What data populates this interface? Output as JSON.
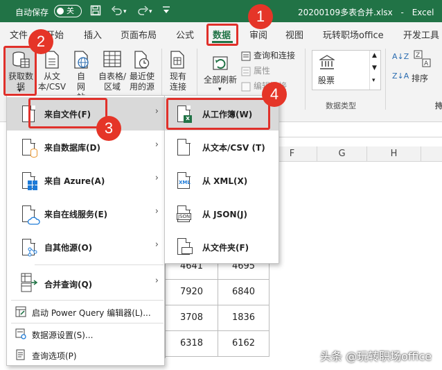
{
  "titlebar": {
    "autosave_label": "自动保存",
    "toggle_state": "关",
    "filename": "20200109多表合并.xlsx",
    "separator": "-",
    "app_name": "Excel"
  },
  "tabs": [
    "文件",
    "开始",
    "插入",
    "页面布局",
    "公式",
    "数据",
    "审阅",
    "视图",
    "玩转职场office",
    "开发工具"
  ],
  "ribbon": {
    "get_data": "获取数据",
    "from_text_csv": "从文本/CSV",
    "from_web": "自网站",
    "from_table": "自表格/区域",
    "recent_sources": "最近使用的源",
    "existing_connections": "现有连接",
    "refresh_all": "全部刷新",
    "queries_connections": "查询和连接",
    "properties": "属性",
    "edit_links": "编辑链接",
    "stocks": "股票",
    "data_types_group": "数据类型",
    "sort": "排序",
    "sort_az": "A↓Z",
    "sort_za": "Z↓A",
    "filter_short": "持"
  },
  "colors": {
    "brand": "#217346",
    "annotation": "#e53528"
  },
  "main_menu": [
    {
      "label": "来自文件(F)",
      "icon": "file-icon",
      "submenu": true
    },
    {
      "label": "来自数据库(D)",
      "icon": "database-icon",
      "submenu": true
    },
    {
      "label": "来自 Azure(A)",
      "icon": "azure-icon",
      "submenu": true
    },
    {
      "label": "来自在线服务(E)",
      "icon": "online-service-icon",
      "submenu": true
    },
    {
      "label": "自其他源(O)",
      "icon": "other-source-icon",
      "submenu": true
    },
    {
      "label": "合并查询(Q)",
      "icon": "merge-query-icon",
      "submenu": true
    },
    {
      "label": "启动 Power Query 编辑器(L)...",
      "icon": "power-query-icon",
      "submenu": false
    },
    {
      "label": "数据源设置(S)...",
      "icon": "datasource-settings-icon",
      "submenu": false
    },
    {
      "label": "查询选项(P)",
      "icon": "query-options-icon",
      "submenu": false
    }
  ],
  "sub_menu": [
    {
      "label": "从工作簿(W)",
      "icon": "excel-workbook-icon"
    },
    {
      "label": "从文本/CSV (T)",
      "icon": "text-file-icon"
    },
    {
      "label": "从 XML(X)",
      "icon": "xml-icon",
      "icon_text": "XML"
    },
    {
      "label": "从 JSON(J)",
      "icon": "json-icon",
      "icon_text": "JSON"
    },
    {
      "label": "从文件夹(F)",
      "icon": "folder-icon"
    }
  ],
  "sheet": {
    "columns": [
      "F",
      "G",
      "H"
    ],
    "rows": [
      [
        "4641",
        "4695"
      ],
      [
        "7920",
        "6840"
      ],
      [
        "3708",
        "1836"
      ],
      [
        "6318",
        "6162"
      ]
    ]
  },
  "badges": [
    "1",
    "2",
    "3",
    "4"
  ],
  "watermark": "头条 @玩转职场office"
}
